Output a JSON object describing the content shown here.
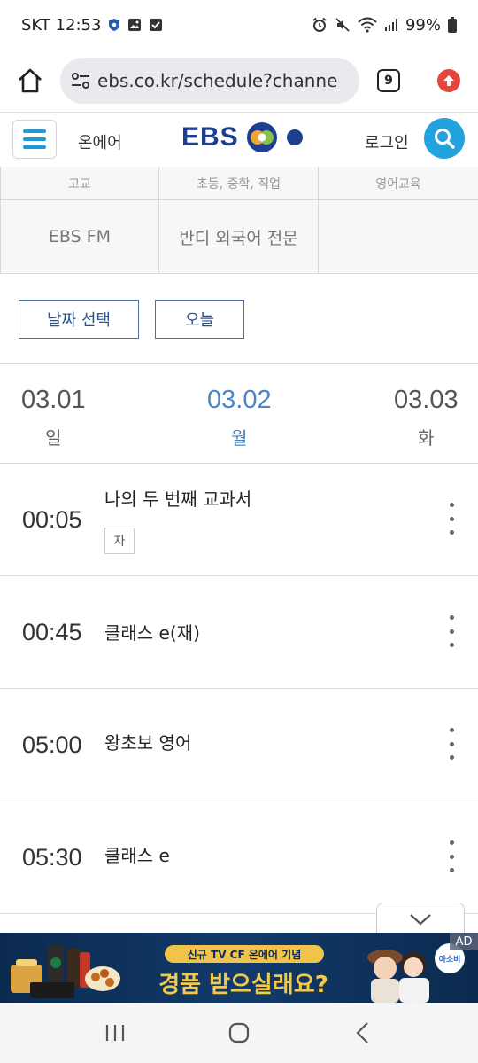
{
  "status_bar": {
    "carrier_time": "SKT 12:53",
    "battery": "99%"
  },
  "browser": {
    "url": "ebs.co.kr/schedule?channe",
    "tab_count": "9"
  },
  "site_header": {
    "onair_label": "온에어",
    "logo_text": "EBS",
    "login_label": "로그인"
  },
  "channels": {
    "top_row": [
      "고교",
      "초등, 중학, 직업",
      "영어교육"
    ],
    "bottom_row": [
      "EBS FM",
      "반디 외국어 전문",
      ""
    ]
  },
  "date_buttons": {
    "select_label": "날짜 선택",
    "today_label": "오늘"
  },
  "dates": [
    {
      "num": "03.01",
      "day": "일",
      "active": false
    },
    {
      "num": "03.02",
      "day": "월",
      "active": true
    },
    {
      "num": "03.03",
      "day": "화",
      "active": false
    }
  ],
  "schedule": [
    {
      "time": "00:05",
      "title": "나의 두 번째 교과서",
      "badge": "자"
    },
    {
      "time": "00:45",
      "title": "클래스 e(재)",
      "badge": ""
    },
    {
      "time": "05:00",
      "title": "왕초보 영어",
      "badge": ""
    },
    {
      "time": "05:30",
      "title": "클래스 e",
      "badge": ""
    }
  ],
  "ad": {
    "tag": "AD",
    "headline_small": "신규 TV CF 온에어 기념",
    "headline_big": "경품 받으실래요?",
    "logo_text": "아소비"
  },
  "colors": {
    "accent_blue": "#23a3de",
    "active_date": "#4a86c8",
    "logo_navy": "#1d3f8f",
    "button_border": "#4a6fa5"
  },
  "icons": {
    "home": "home-icon",
    "site_info": "tune-icon",
    "update": "arrow-up-icon",
    "menu": "hamburger-icon",
    "search": "search-icon",
    "more": "more-vertical-icon",
    "scroll": "chevron-down-icon"
  }
}
